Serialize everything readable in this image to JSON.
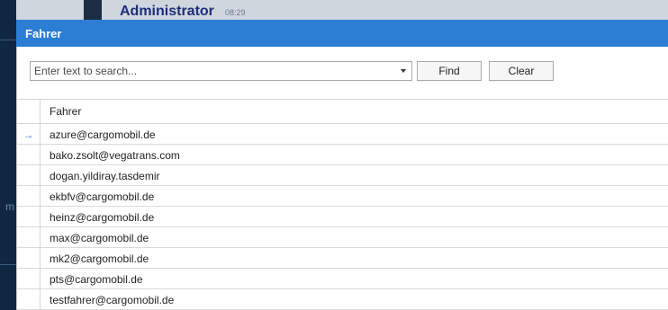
{
  "background": {
    "user": "Administrator",
    "time": "08:29",
    "side_letter": "m"
  },
  "dialog": {
    "title": "Fahrer",
    "search": {
      "placeholder": "Enter text to search...",
      "value": ""
    },
    "find_label": "Find",
    "clear_label": "Clear",
    "grid": {
      "column_header": "Fahrer",
      "current_row_indicator": "arrow-right-icon",
      "rows": [
        "azure@cargomobil.de",
        "bako.zsolt@vegatrans.com",
        "dogan.yildiray.tasdemir",
        "ekbfv@cargomobil.de",
        "heinz@cargomobil.de",
        "max@cargomobil.de",
        "mk2@cargomobil.de",
        "pts@cargomobil.de",
        "testfahrer@cargomobil.de"
      ]
    }
  },
  "colors": {
    "titlebar": "#2b7ed3",
    "background_app": "#1f3f66",
    "username": "#1f2e7a"
  }
}
